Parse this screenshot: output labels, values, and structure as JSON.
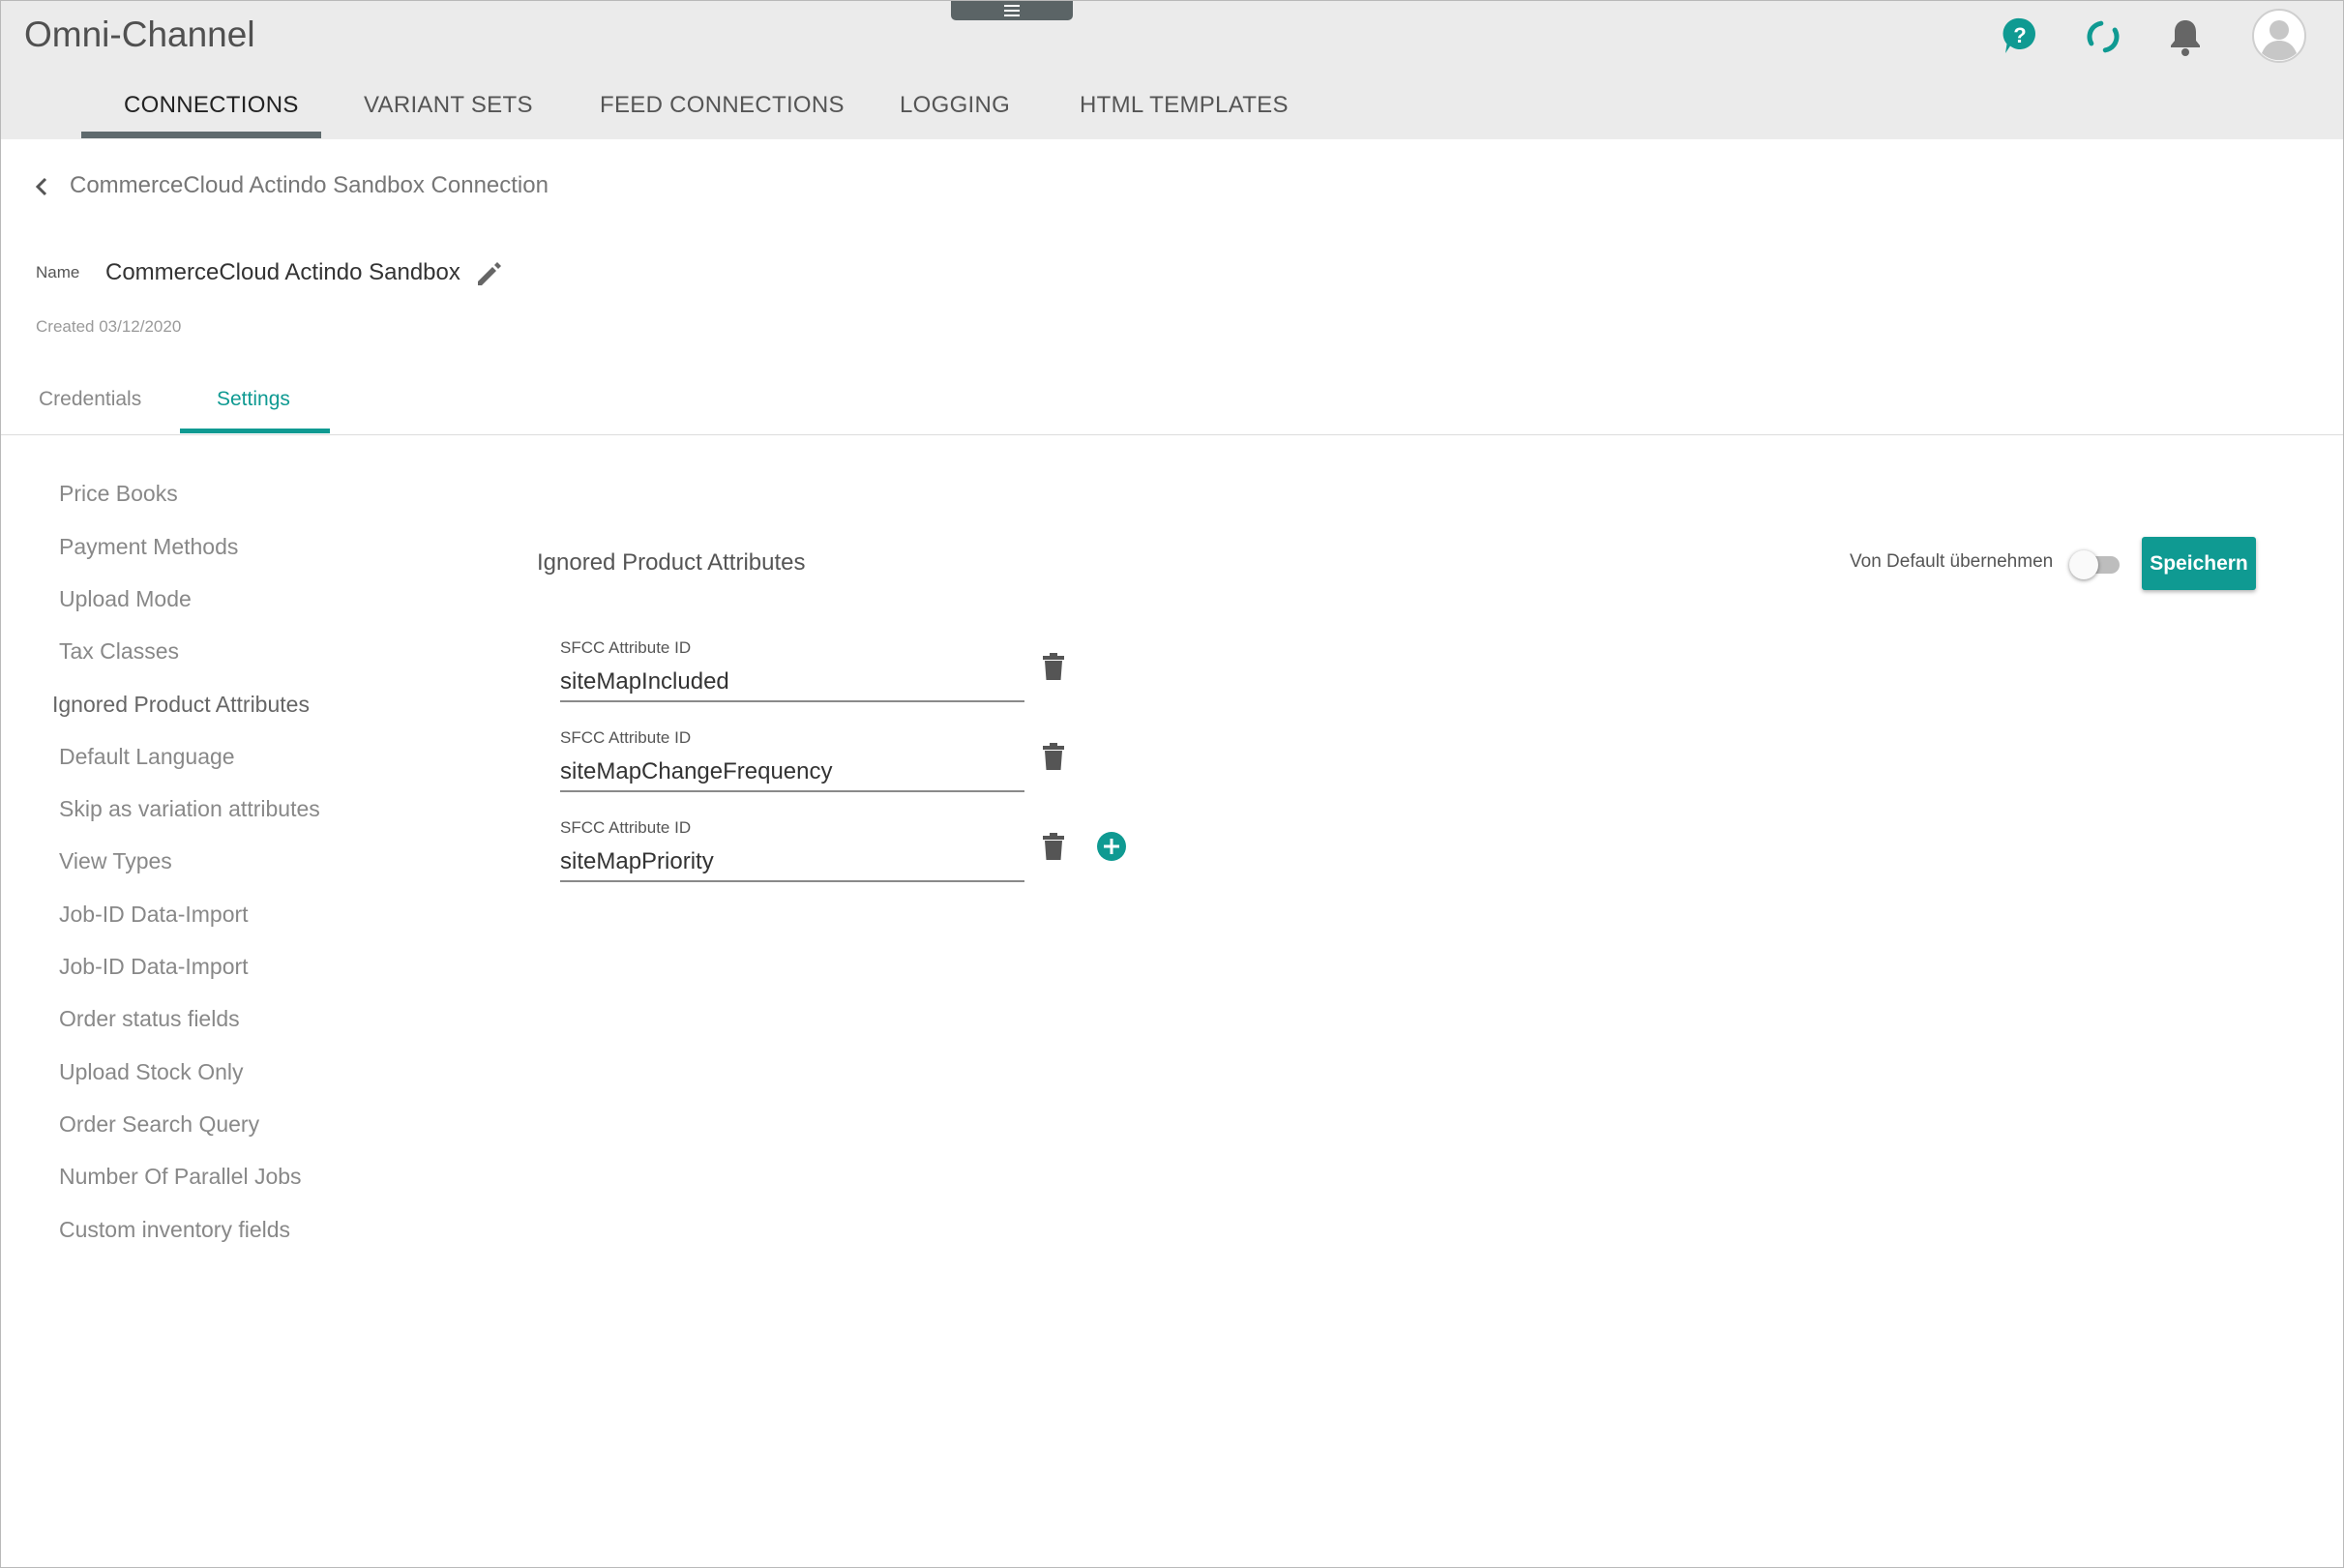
{
  "app": {
    "title": "Omni-Channel"
  },
  "header": {
    "icons": [
      "help-icon",
      "sync-icon",
      "bell-icon",
      "avatar-icon"
    ],
    "accent_color": "#0f9a92"
  },
  "nav": {
    "tabs": [
      {
        "label": "CONNECTIONS",
        "active": true
      },
      {
        "label": "VARIANT SETS"
      },
      {
        "label": "FEED CONNECTIONS"
      },
      {
        "label": "LOGGING"
      },
      {
        "label": "HTML TEMPLATES"
      }
    ]
  },
  "breadcrumb": {
    "title": "CommerceCloud Actindo Sandbox Connection"
  },
  "connection": {
    "name_label": "Name",
    "name": "CommerceCloud Actindo Sandbox",
    "created": "Created 03/12/2020"
  },
  "subtabs": [
    {
      "label": "Credentials",
      "active": false
    },
    {
      "label": "Settings",
      "active": true
    }
  ],
  "sidebar": {
    "items": [
      {
        "label": "Price Books"
      },
      {
        "label": "Payment Methods"
      },
      {
        "label": "Upload Mode"
      },
      {
        "label": "Tax Classes"
      },
      {
        "label": "Ignored Product Attributes",
        "active": true
      },
      {
        "label": "Default Language"
      },
      {
        "label": "Skip as variation attributes"
      },
      {
        "label": "View Types"
      },
      {
        "label": "Job-ID Data-Import"
      },
      {
        "label": "Job-ID Data-Import"
      },
      {
        "label": "Order status fields"
      },
      {
        "label": "Upload Stock Only"
      },
      {
        "label": "Order Search Query"
      },
      {
        "label": "Number Of Parallel Jobs"
      },
      {
        "label": "Custom inventory fields"
      }
    ]
  },
  "section": {
    "title": "Ignored Product Attributes",
    "default_toggle_label": "Von Default übernehmen",
    "default_toggle_on": false,
    "save_label": "Speichern",
    "attributes": [
      {
        "label": "SFCC Attribute ID",
        "value": "siteMapIncluded"
      },
      {
        "label": "SFCC Attribute ID",
        "value": "siteMapChangeFrequency"
      },
      {
        "label": "SFCC Attribute ID",
        "value": "siteMapPriority"
      }
    ]
  }
}
